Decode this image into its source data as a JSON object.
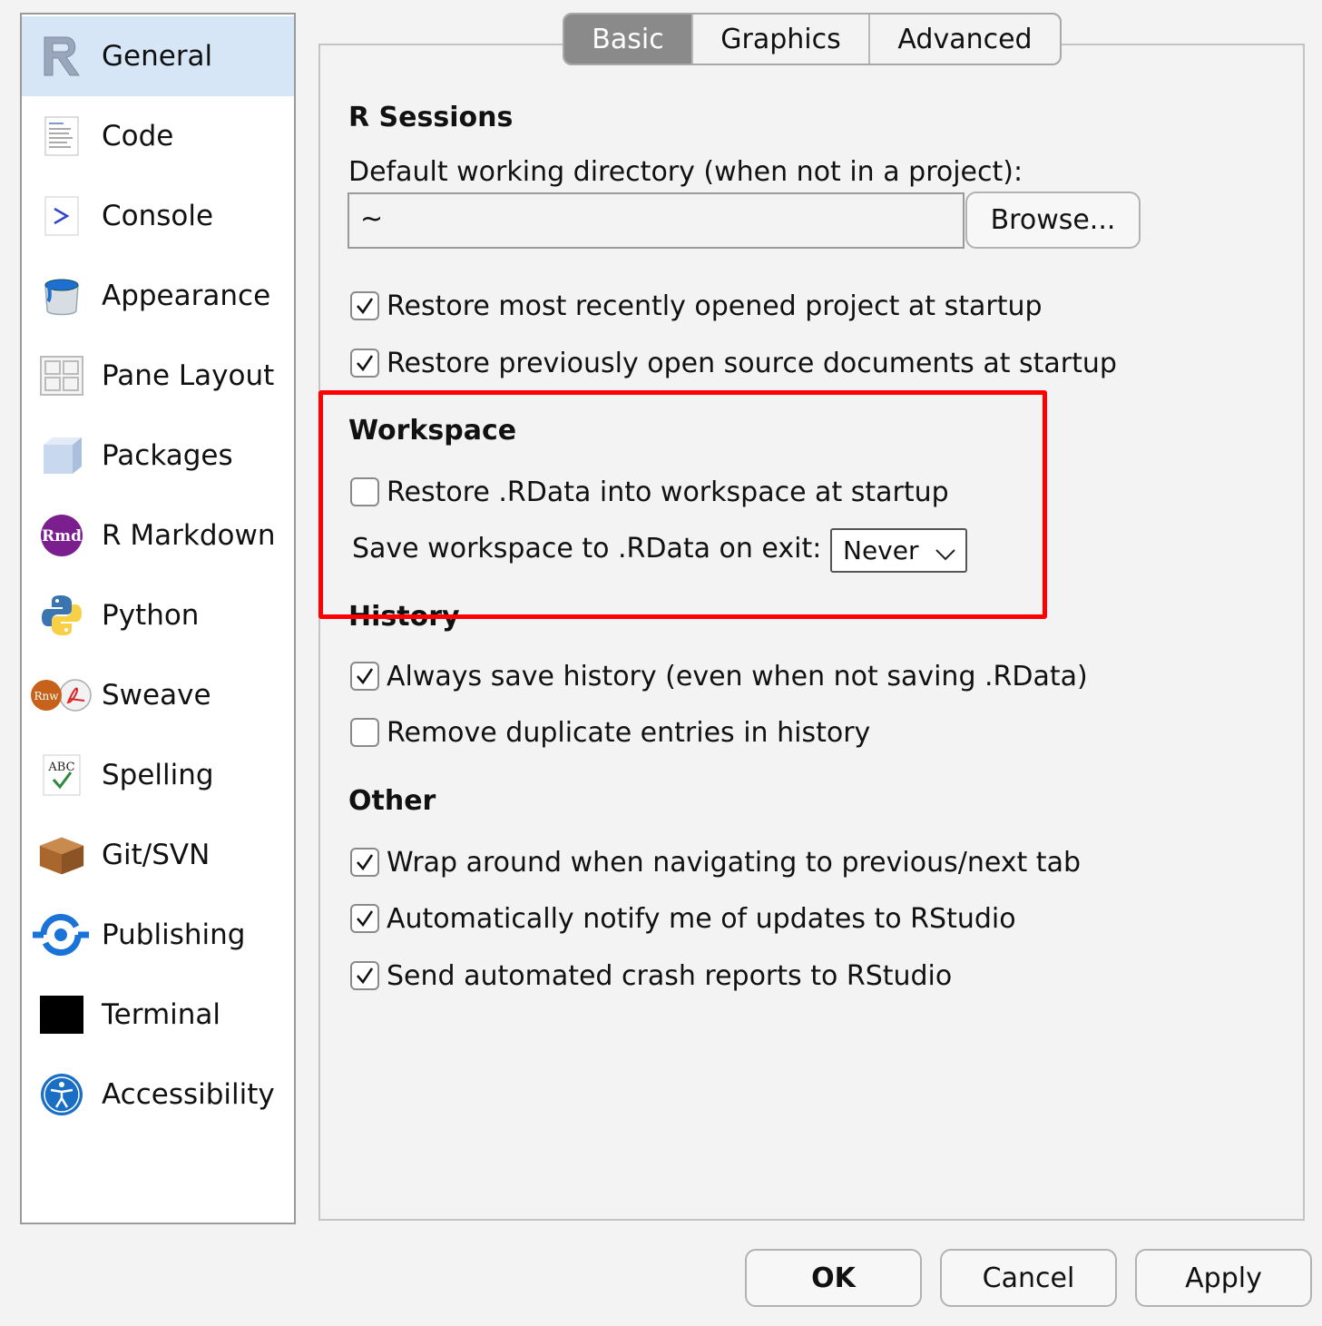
{
  "sidebar": {
    "items": [
      {
        "label": "General",
        "icon": "r-logo-icon",
        "selected": true
      },
      {
        "label": "Code",
        "icon": "code-file-icon"
      },
      {
        "label": "Console",
        "icon": "console-prompt-icon"
      },
      {
        "label": "Appearance",
        "icon": "paint-bucket-icon"
      },
      {
        "label": "Pane Layout",
        "icon": "pane-grid-icon"
      },
      {
        "label": "Packages",
        "icon": "package-cube-icon"
      },
      {
        "label": "R Markdown",
        "icon": "rmd-icon",
        "icon_text": "Rmd"
      },
      {
        "label": "Python",
        "icon": "python-icon"
      },
      {
        "label": "Sweave",
        "icon": "sweave-icon",
        "icon_text": "Rnw"
      },
      {
        "label": "Spelling",
        "icon": "spelling-abc-icon",
        "icon_text": "ABC"
      },
      {
        "label": "Git/SVN",
        "icon": "git-box-icon"
      },
      {
        "label": "Publishing",
        "icon": "publishing-icon"
      },
      {
        "label": "Terminal",
        "icon": "terminal-icon"
      },
      {
        "label": "Accessibility",
        "icon": "accessibility-icon"
      }
    ]
  },
  "tabs": [
    {
      "label": "Basic",
      "active": true
    },
    {
      "label": "Graphics",
      "active": false
    },
    {
      "label": "Advanced",
      "active": false
    }
  ],
  "r_sessions": {
    "title": "R Sessions",
    "dir_label": "Default working directory (when not in a project):",
    "dir_value": "~",
    "browse_label": "Browse...",
    "restore_project": {
      "label": "Restore most recently opened project at startup",
      "checked": true
    },
    "restore_docs": {
      "label": "Restore previously open source documents at startup",
      "checked": true
    }
  },
  "workspace": {
    "title": "Workspace",
    "restore_rdata": {
      "label": "Restore .RData into workspace at startup",
      "checked": false
    },
    "save_label": "Save workspace to .RData on exit:",
    "save_value": "Never"
  },
  "history": {
    "title": "History",
    "always_save": {
      "label": "Always save history (even when not saving .RData)",
      "checked": true
    },
    "remove_dupes": {
      "label": "Remove duplicate entries in history",
      "checked": false
    }
  },
  "other": {
    "title": "Other",
    "wrap_tabs": {
      "label": "Wrap around when navigating to previous/next tab",
      "checked": true
    },
    "notify_updates": {
      "label": "Automatically notify me of updates to RStudio",
      "checked": true
    },
    "crash_reports": {
      "label": "Send automated crash reports to RStudio",
      "checked": true
    }
  },
  "footer": {
    "ok": "OK",
    "cancel": "Cancel",
    "apply": "Apply"
  },
  "colors": {
    "highlight": "#ff0000",
    "selected_sidebar": "#d6e6f6",
    "active_tab": "#8a8a8a"
  }
}
